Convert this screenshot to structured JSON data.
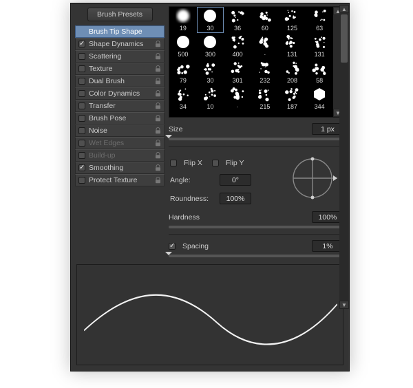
{
  "presets_button": "Brush Presets",
  "options": [
    {
      "key": "tip",
      "label": "Brush Tip Shape",
      "checkbox": false,
      "checked": false,
      "lock": false,
      "selected": true
    },
    {
      "key": "shape",
      "label": "Shape Dynamics",
      "checkbox": true,
      "checked": true,
      "lock": true
    },
    {
      "key": "scattering",
      "label": "Scattering",
      "checkbox": true,
      "checked": false,
      "lock": true
    },
    {
      "key": "texture",
      "label": "Texture",
      "checkbox": true,
      "checked": false,
      "lock": true
    },
    {
      "key": "dual",
      "label": "Dual Brush",
      "checkbox": true,
      "checked": false,
      "lock": true
    },
    {
      "key": "colordyn",
      "label": "Color Dynamics",
      "checkbox": true,
      "checked": false,
      "lock": true
    },
    {
      "key": "transfer",
      "label": "Transfer",
      "checkbox": true,
      "checked": false,
      "lock": true
    },
    {
      "key": "pose",
      "label": "Brush Pose",
      "checkbox": true,
      "checked": false,
      "lock": true
    },
    {
      "key": "noise",
      "label": "Noise",
      "checkbox": true,
      "checked": false,
      "lock": true
    },
    {
      "key": "wet",
      "label": "Wet Edges",
      "checkbox": true,
      "checked": false,
      "lock": true,
      "dim": true
    },
    {
      "key": "build",
      "label": "Build-up",
      "checkbox": true,
      "checked": false,
      "lock": true,
      "dim": true
    },
    {
      "key": "smoothing",
      "label": "Smoothing",
      "checkbox": true,
      "checked": true,
      "lock": true
    },
    {
      "key": "protect",
      "label": "Protect Texture",
      "checkbox": true,
      "checked": false,
      "lock": true
    }
  ],
  "swatches": {
    "selected_index": 1,
    "items": [
      {
        "id": 19,
        "shape": "soft-round"
      },
      {
        "id": 30,
        "shape": "hard-round"
      },
      {
        "id": 36,
        "shape": "splat"
      },
      {
        "id": 60,
        "shape": "splat"
      },
      {
        "id": 125,
        "shape": "splat"
      },
      {
        "id": 63,
        "shape": "splat"
      },
      {
        "id": 500,
        "shape": "hard-round"
      },
      {
        "id": 300,
        "shape": "hard-round"
      },
      {
        "id": 400,
        "shape": "splat"
      },
      {
        "id": "·",
        "shape": "splat"
      },
      {
        "id": 131,
        "shape": "splat"
      },
      {
        "id": 131,
        "shape": "splat"
      },
      {
        "id": 79,
        "shape": "splat"
      },
      {
        "id": 30,
        "shape": "splat"
      },
      {
        "id": 301,
        "shape": "splat"
      },
      {
        "id": 232,
        "shape": "splat"
      },
      {
        "id": 208,
        "shape": "splat"
      },
      {
        "id": 58,
        "shape": "splat"
      },
      {
        "id": 34,
        "shape": "splat"
      },
      {
        "id": 10,
        "shape": "splat"
      },
      {
        "id": "·",
        "shape": "splat"
      },
      {
        "id": 215,
        "shape": "splat"
      },
      {
        "id": 187,
        "shape": "splat"
      },
      {
        "id": 344,
        "shape": "hexagon"
      }
    ]
  },
  "size": {
    "label": "Size",
    "value": "1 px",
    "pos": 0
  },
  "flip": {
    "x_label": "Flip X",
    "y_label": "Flip Y",
    "x": false,
    "y": false
  },
  "angle": {
    "label": "Angle:",
    "value": "0°"
  },
  "roundness": {
    "label": "Roundness:",
    "value": "100%"
  },
  "hardness": {
    "label": "Hardness",
    "value": "100%",
    "pos": 100
  },
  "spacing": {
    "label": "Spacing",
    "value": "1%",
    "checked": true,
    "pos": 0
  }
}
